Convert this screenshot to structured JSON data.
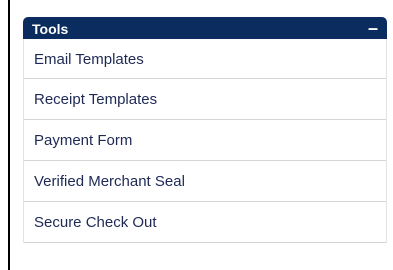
{
  "panel": {
    "title": "Tools",
    "collapse_symbol": "–",
    "items": [
      {
        "label": "Email Templates"
      },
      {
        "label": "Receipt Templates"
      },
      {
        "label": "Payment Form"
      },
      {
        "label": "Verified Merchant Seal"
      },
      {
        "label": "Secure Check Out"
      }
    ]
  },
  "colors": {
    "header_bg": "#0a2c5e",
    "link_text": "#1e2a55",
    "divider": "#d4d4d4"
  }
}
